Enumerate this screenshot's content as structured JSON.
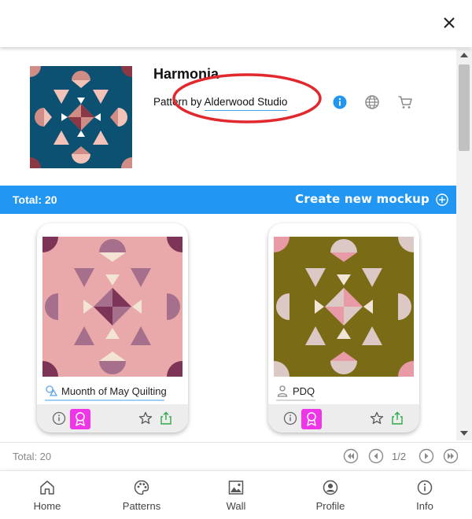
{
  "window": {
    "close_icon": "close-icon"
  },
  "pattern": {
    "title": "Harmonia",
    "by_prefix": "Pattern by ",
    "designer": "Alderwood Studio",
    "icons": [
      "info-icon",
      "globe-icon",
      "cart-icon"
    ],
    "thumb_colors": {
      "background": "#0d5172",
      "blush": "#f2c2b8",
      "rose": "#cf8d86",
      "maroon": "#8a3944",
      "white": "#ffffff"
    }
  },
  "mockups_bar": {
    "total_label": "Total: 20",
    "create_label": "Create new mockup",
    "color": "#2196f3"
  },
  "mockups": [
    {
      "name": "Muonth of May Quilting",
      "icon": "shapes-icon",
      "colors": {
        "background": "#e9a9ab",
        "mauve": "#a66f8b",
        "plum": "#7d3457",
        "cream": "#f3e3d3"
      }
    },
    {
      "name": "PDQ",
      "icon": "person-icon",
      "colors": {
        "background": "#7a6b16",
        "floral": "#dcc8c4",
        "pink": "#e89aa6",
        "cream": "#f1e5d8"
      }
    }
  ],
  "card_actions": [
    "info-icon",
    "badge-icon",
    "star-icon",
    "share-icon"
  ],
  "pagination": {
    "total_label": "Total: 20",
    "page": "1/2"
  },
  "nav": [
    {
      "label": "Home",
      "icon": "home-icon"
    },
    {
      "label": "Patterns",
      "icon": "palette-icon"
    },
    {
      "label": "Wall",
      "icon": "wall-icon"
    },
    {
      "label": "Profile",
      "icon": "profile-icon"
    },
    {
      "label": "Info",
      "icon": "info-icon"
    }
  ]
}
